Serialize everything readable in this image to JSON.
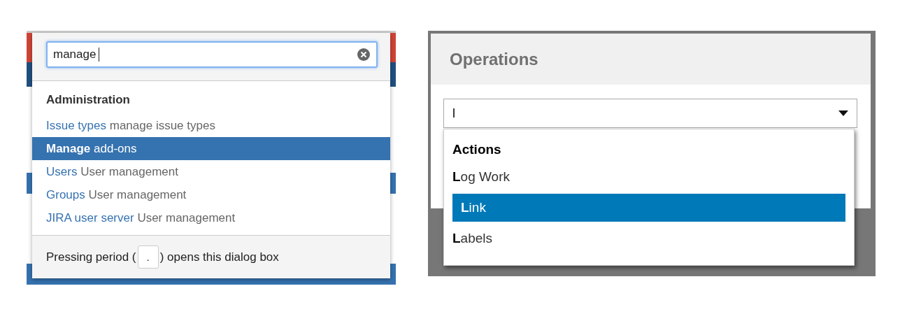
{
  "quick_search": {
    "query": "manage",
    "section_title": "Administration",
    "results": [
      {
        "label": "Issue types",
        "description": "manage issue types",
        "selected": false
      },
      {
        "label": "Manage",
        "description": "add-ons",
        "selected": true
      },
      {
        "label": "Users",
        "description": "User management",
        "selected": false
      },
      {
        "label": "Groups",
        "description": "User management",
        "selected": false
      },
      {
        "label": "JIRA user server",
        "description": "User management",
        "selected": false
      }
    ],
    "footer_before": "Pressing period (",
    "key": ".",
    "footer_after": ") opens this dialog box"
  },
  "operations_dialog": {
    "title": "Operations",
    "query": "l",
    "group_title": "Actions",
    "items": [
      {
        "label": "**L**og Work",
        "selected": false
      },
      {
        "label": "**L**ink",
        "selected": true
      },
      {
        "label": "**L**abels",
        "selected": false
      }
    ]
  }
}
